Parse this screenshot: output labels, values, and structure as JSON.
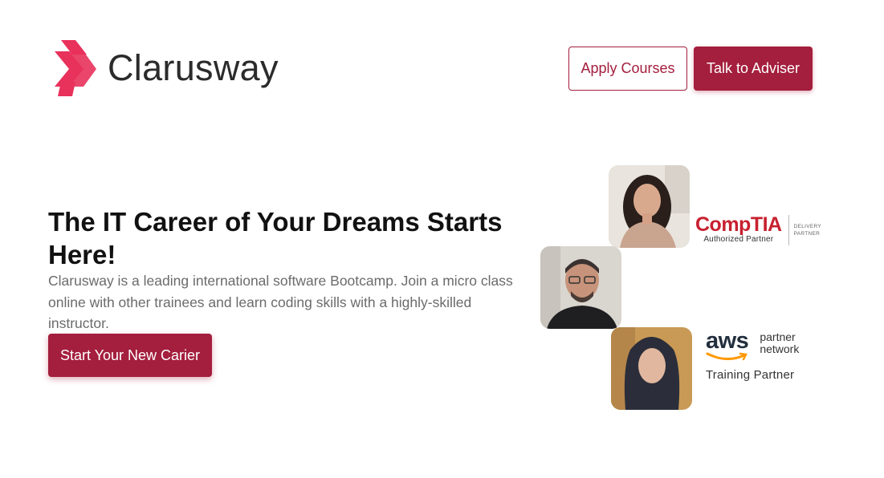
{
  "brand": {
    "name": "Clarusway",
    "logo_icon": "chevron-arrows-icon",
    "accent_color": "#a41e3d",
    "logo_color": "#e8315b"
  },
  "header": {
    "apply_label": "Apply Courses",
    "adviser_label": "Talk to Adviser"
  },
  "hero": {
    "title": "The IT Career of Your Dreams Starts Here!",
    "description": "Clarusway is a leading international software Bootcamp. Join a micro class online with other trainees and learn coding skills with a highly-skilled instructor.",
    "cta_label": "Start Your New Carier"
  },
  "partners": {
    "comptia": {
      "name": "CompTIA",
      "subtitle": "Authorized Partner",
      "badge_line1": "DELIVERY",
      "badge_line2": "PARTNER"
    },
    "aws": {
      "name": "aws",
      "line1": "partner",
      "line2": "network",
      "subtitle": "Training Partner"
    }
  }
}
